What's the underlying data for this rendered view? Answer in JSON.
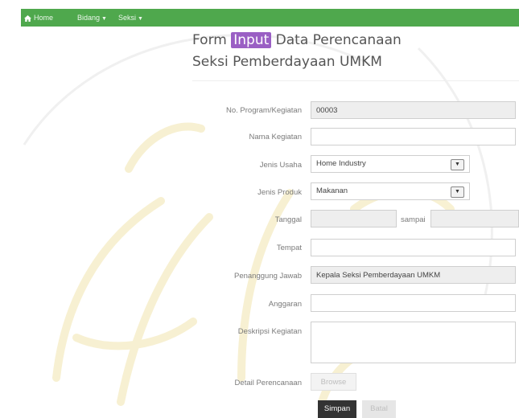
{
  "navbar": {
    "home_label": "Home",
    "bidang_label": "Bidang",
    "seksi_label": "Seksi",
    "color": "#4fa84d"
  },
  "title": {
    "prefix": "Form",
    "highlight": "Input",
    "suffix": "Data Perencanaan",
    "subtitle": "Seksi Pemberdayaan UMKM",
    "highlight_color": "#9a5fc4"
  },
  "form": {
    "no_program": {
      "label": "No. Program/Kegiatan",
      "value": "00003"
    },
    "nama_kegiatan": {
      "label": "Nama Kegiatan",
      "value": ""
    },
    "jenis_usaha": {
      "label": "Jenis Usaha",
      "value": "Home Industry"
    },
    "jenis_produk": {
      "label": "Jenis Produk",
      "value": "Makanan"
    },
    "tanggal": {
      "label": "Tanggal",
      "value_from": "",
      "sampai_label": "sampai",
      "value_to": ""
    },
    "tempat": {
      "label": "Tempat",
      "value": ""
    },
    "penanggung_jawab": {
      "label": "Penanggung Jawab",
      "value": "Kepala Seksi Pemberdayaan UMKM"
    },
    "anggaran": {
      "label": "Anggaran",
      "value": ""
    },
    "deskripsi": {
      "label": "Deskripsi Kegiatan",
      "value": ""
    },
    "detail": {
      "label": "Detail Perencanaan",
      "browse_label": "Browse"
    }
  },
  "actions": {
    "save_label": "Simpan",
    "cancel_label": "Batal"
  }
}
